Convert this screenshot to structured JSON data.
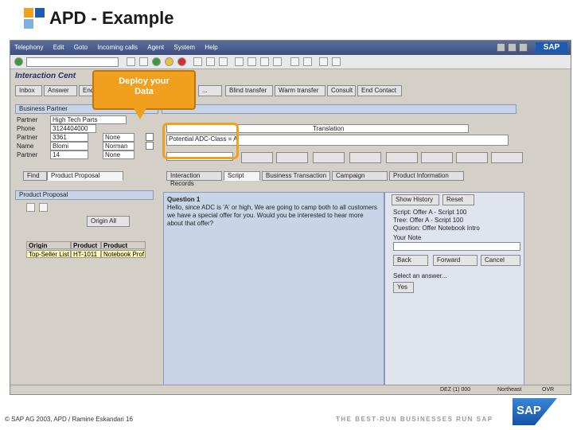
{
  "slide": {
    "title": "APD - Example",
    "footer_copyright": "© SAP AG 2003, APD / Ramine Eskandari 16",
    "tagline": "THE BEST-RUN BUSINESSES RUN SAP",
    "logo_text": "SAP"
  },
  "colors": {
    "callout": "#f0a01e",
    "titlebar": "#3d5080",
    "panel": "#c8d4e8",
    "accent_blue": "#1c5cb0"
  },
  "sap_window": {
    "menu": [
      "Telephony",
      "Edit",
      "Goto",
      "Incoming calls",
      "Agent",
      "System",
      "Help"
    ],
    "logo_text": "SAP",
    "app_title": "Interaction Cent",
    "buttons": [
      "Inbox",
      "Answer",
      "End",
      "...",
      "Blind transfer",
      "Warm transfer",
      "Consult",
      "End Contact"
    ],
    "business_partner": {
      "header": "Business Partner",
      "labels": [
        "Partner",
        "Phone",
        "Partner",
        "Name",
        "Partner"
      ],
      "values": [
        "High Tech Parts",
        "3124404000",
        "3361",
        "Blomi",
        "14"
      ],
      "extra_values": [
        "",
        "",
        "None",
        "Norman",
        "None"
      ]
    },
    "highlight_fields": {
      "label": "Translation",
      "value": "Potential ADC-Class = A"
    },
    "left_tabs": [
      "Find",
      "Product Proposal"
    ],
    "right_tabs": [
      "Interaction Records",
      "Script",
      "Business Transaction",
      "Campaign",
      "Product Information"
    ],
    "product_proposal": {
      "header": "Product Proposal",
      "columns": [
        "Origin",
        "Product",
        "Product Descrip"
      ],
      "rows": [
        [
          "Top-Seller List",
          "HT-1011",
          "Notebook Prof"
        ]
      ],
      "toolbar_label": "Origin All"
    },
    "script": {
      "header": "Question 1",
      "text": "Hello, since ADC is 'A' or high, We are going to camp both to all customers we have a special offer for you. Would you be interested to hear more about that offer?"
    },
    "right_panel": {
      "buttons": [
        "Show History",
        "Reset"
      ],
      "lines": [
        "Script: Offer A - Script 100",
        "Tree: Offer A - Script 100",
        "Question: Offer Notebook Intro"
      ],
      "answer_label": "Your Note",
      "nav_buttons": [
        "Back",
        "Forward",
        "Cancel"
      ],
      "prompt": "Select an answer...",
      "answer": "Yes"
    },
    "status": [
      "DEZ (1) 000",
      "Northeast",
      "OVR"
    ]
  },
  "callout": {
    "text_line1": "Deploy your",
    "text_line2": "Data"
  }
}
